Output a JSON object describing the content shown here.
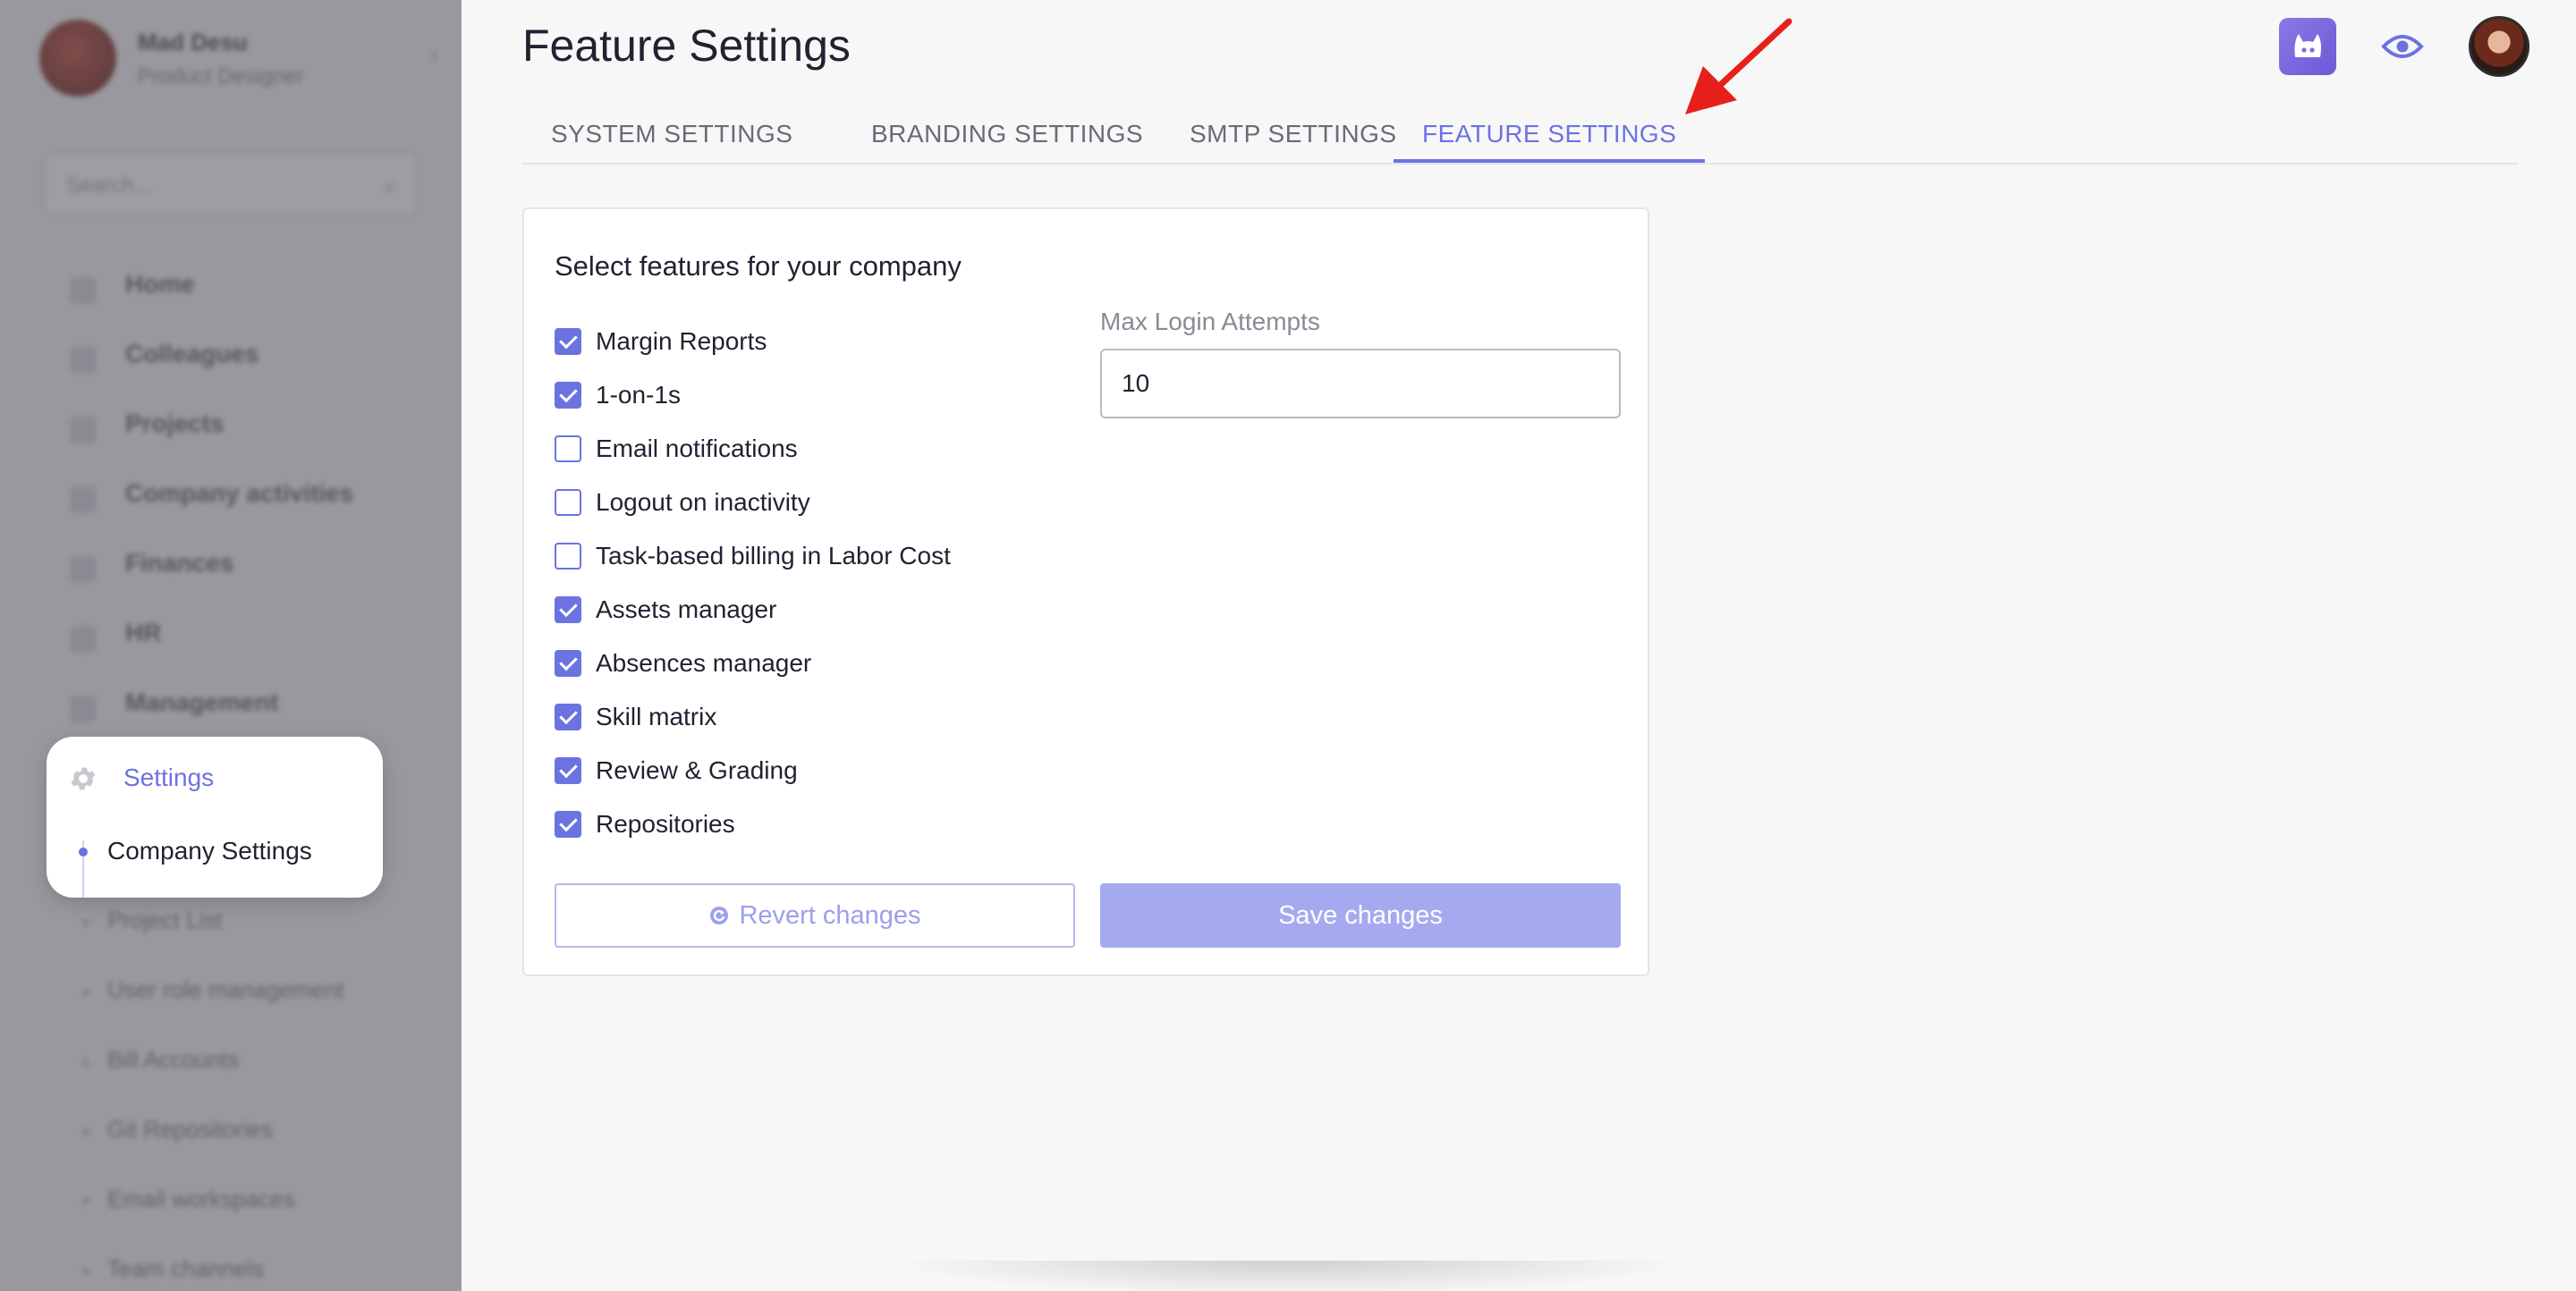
{
  "sidebar": {
    "user_name": "Mad Desu",
    "user_role": "Product Designer",
    "search_placeholder": "Search...",
    "items": [
      {
        "label": "Home"
      },
      {
        "label": "Colleagues"
      },
      {
        "label": "Projects"
      },
      {
        "label": "Company activities"
      },
      {
        "label": "Finances"
      },
      {
        "label": "HR"
      },
      {
        "label": "Management"
      }
    ],
    "settings_label": "Settings",
    "settings_sub": "Company Settings",
    "sub_items": [
      {
        "label": "Project List"
      },
      {
        "label": "User role management"
      },
      {
        "label": "Bill Accounts"
      },
      {
        "label": "Git Repositories"
      },
      {
        "label": "Email workspaces"
      },
      {
        "label": "Team channels"
      }
    ]
  },
  "header": {
    "title": "Feature Settings"
  },
  "tabs": [
    {
      "label": "SYSTEM SETTINGS"
    },
    {
      "label": "BRANDING SETTINGS"
    },
    {
      "label": "SMTP SETTINGS"
    },
    {
      "label": "FEATURE SETTINGS"
    }
  ],
  "card": {
    "title": "Select features for your company",
    "features": [
      {
        "label": "Margin Reports",
        "checked": true
      },
      {
        "label": "1-on-1s",
        "checked": true
      },
      {
        "label": "Email notifications",
        "checked": false
      },
      {
        "label": "Logout on inactivity",
        "checked": false
      },
      {
        "label": "Task-based billing in Labor Cost",
        "checked": false
      },
      {
        "label": "Assets manager",
        "checked": true
      },
      {
        "label": "Absences manager",
        "checked": true
      },
      {
        "label": "Skill matrix",
        "checked": true
      },
      {
        "label": "Review & Grading",
        "checked": true
      },
      {
        "label": "Repositories",
        "checked": true
      }
    ],
    "max_login_label": "Max Login Attempts",
    "max_login_value": "10",
    "revert_label": "Revert changes",
    "save_label": "Save changes"
  },
  "colors": {
    "accent": "#6c73e0",
    "accent_light": "#a5aaf0",
    "annotation_arrow": "#e8201c"
  }
}
